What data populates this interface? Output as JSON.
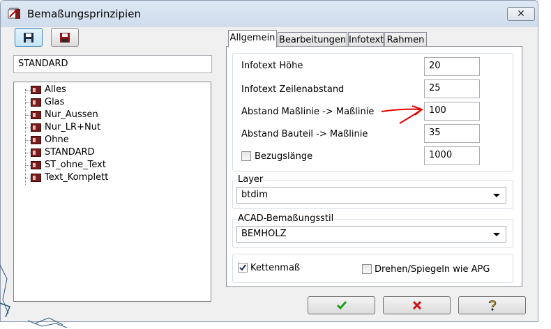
{
  "window": {
    "title": "Bemaßungsprinzipien",
    "close_glyph": "✕",
    "app_icon": "app-icon",
    "colors": {
      "accent": "#3c7fb1",
      "arrow": "#e00000",
      "ok": "#1e9b1e",
      "cancel": "#d01010"
    }
  },
  "toolbar": {
    "save_icon": "floppy-disk-icon",
    "save_red_icon": "floppy-disk-red-icon"
  },
  "profile_name": "STANDARD",
  "tree": {
    "items": [
      {
        "label": "Alles"
      },
      {
        "label": "Glas"
      },
      {
        "label": "Nur_Aussen"
      },
      {
        "label": "Nur_LR+Nut"
      },
      {
        "label": "Ohne"
      },
      {
        "label": "STANDARD"
      },
      {
        "label": "ST_ohne_Text"
      },
      {
        "label": "Text_Komplett"
      }
    ]
  },
  "tabs": [
    {
      "label": "Allgemein",
      "selected": true
    },
    {
      "label": "Bearbeitungen"
    },
    {
      "label": "Infotext"
    },
    {
      "label": "Rahmen"
    }
  ],
  "fields": {
    "infotext_hoehe": {
      "label": "Infotext Höhe",
      "value": "20"
    },
    "infotext_zeilenabstand": {
      "label": "Infotext Zeilenabstand",
      "value": "25"
    },
    "abstand_masslinie": {
      "label": "Abstand Maßlinie -> Maßlinie",
      "value": "100"
    },
    "abstand_bauteil": {
      "label": "Abstand Bauteil -> Maßlinie",
      "value": "35"
    },
    "bezugslaenge": {
      "label": "Bezugslänge",
      "value": "1000",
      "checked": false
    }
  },
  "layer": {
    "legend": "Layer",
    "value": "btdim"
  },
  "acad": {
    "legend": "ACAD-Bemaßungsstil",
    "value": "BEMHOLZ"
  },
  "options": {
    "kettenmass": {
      "label": "Kettenmaß",
      "checked": true
    },
    "drehen": {
      "label": "Drehen/Spiegeln wie APG",
      "checked": false
    }
  },
  "buttons": {
    "ok_icon": "checkmark-icon",
    "cancel_icon": "cross-icon",
    "help_icon": "help-icon"
  }
}
